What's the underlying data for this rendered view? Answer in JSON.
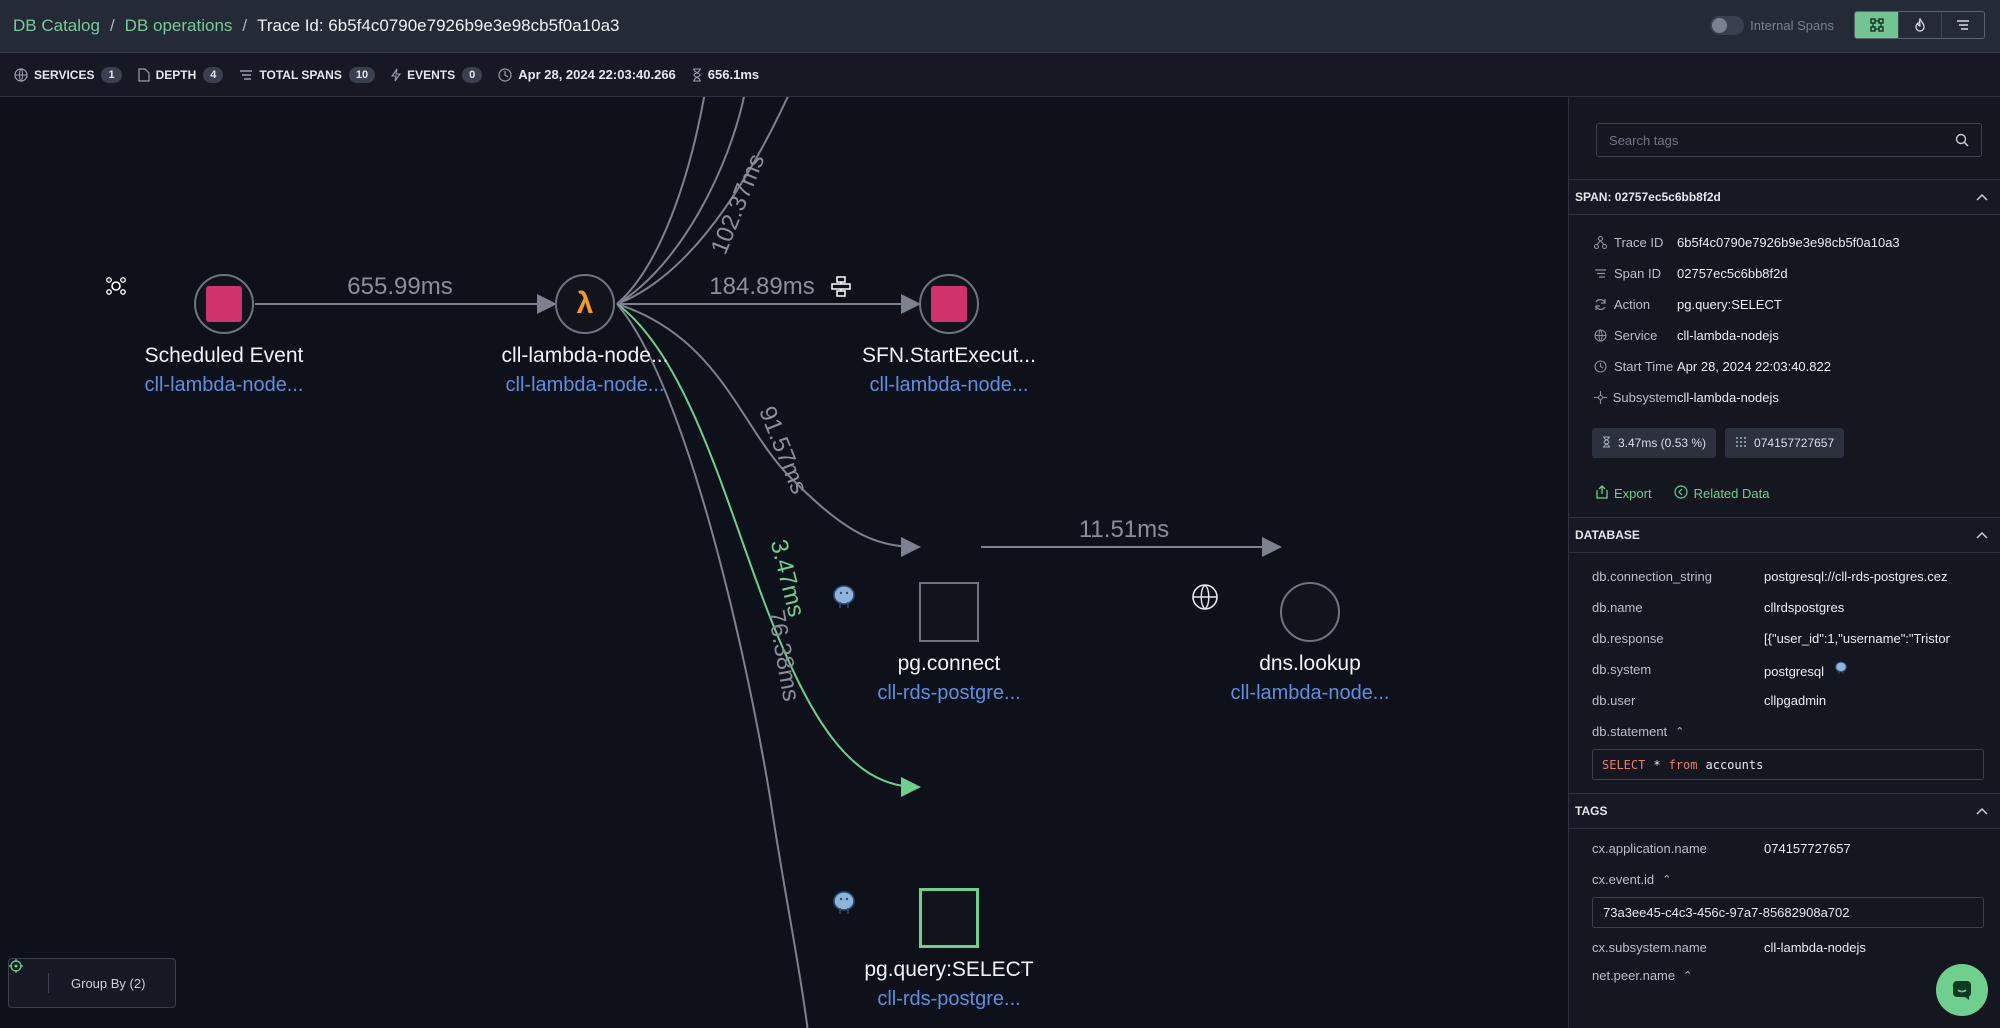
{
  "breadcrumb": [
    "DB Catalog",
    "DB operations",
    "Trace Id: 6b5f4c0790e7926b9e3e98cb5f0a10a3"
  ],
  "top_right": {
    "toggle_label": "Internal Spans",
    "views": [
      "graph-view-icon",
      "flame-view-icon",
      "list-view-icon"
    ]
  },
  "stats": {
    "services_label": "SERVICES",
    "services": "1",
    "depth_label": "DEPTH",
    "depth": "4",
    "total_spans_label": "TOTAL SPANS",
    "total_spans": "10",
    "events_label": "EVENTS",
    "events": "0",
    "start_time": "Apr 28, 2024 22:03:40.266",
    "duration": "656.1ms"
  },
  "graph": {
    "nodes": {
      "scheduled": {
        "name": "Scheduled Event",
        "sub": "cll-lambda-node..."
      },
      "lambda": {
        "name": "cll-lambda-node...",
        "sub": "cll-lambda-node..."
      },
      "sfn": {
        "name": "SFN.StartExecut...",
        "sub": "cll-lambda-node..."
      },
      "pgconnect": {
        "name": "pg.connect",
        "sub": "cll-rds-postgre..."
      },
      "dns": {
        "name": "dns.lookup",
        "sub": "cll-lambda-node..."
      },
      "pgquery": {
        "name": "pg.query:SELECT",
        "sub": "cll-rds-postgre..."
      }
    },
    "edges": {
      "e1": "655.99ms",
      "e2": "184.89ms",
      "e3": "102.37ms",
      "e4": "91.57ms",
      "e5": "11.51ms",
      "e6": "3.47ms",
      "e7": "76.38ms"
    },
    "group_by": "Group By (2)"
  },
  "panel": {
    "search_placeholder": "Search tags",
    "span_header": "SPAN: 02757ec5c6bb8f2d",
    "span_info": [
      {
        "label": "Trace ID",
        "value": "6b5f4c0790e7926b9e3e98cb5f0a10a3"
      },
      {
        "label": "Span ID",
        "value": "02757ec5c6bb8f2d"
      },
      {
        "label": "Action",
        "value": "pg.query:SELECT"
      },
      {
        "label": "Service",
        "value": "cll-lambda-nodejs"
      },
      {
        "label": "Start Time",
        "value": "Apr 28, 2024 22:03:40.822"
      },
      {
        "label": "Subsystem",
        "value": "cll-lambda-nodejs"
      }
    ],
    "chip_duration": "3.47ms (0.53 %)",
    "chip_id": "074157727657",
    "export": "Export",
    "related": "Related Data",
    "database_header": "DATABASE",
    "database": [
      {
        "label": "db.connection_string",
        "value": "postgresql://cll-rds-postgres.cez"
      },
      {
        "label": "db.name",
        "value": "cllrdspostgres"
      },
      {
        "label": "db.response",
        "value": "[{\"user_id\":1,\"username\":\"Tristor"
      },
      {
        "label": "db.system",
        "value": "postgresql"
      },
      {
        "label": "db.user",
        "value": "cllpgadmin"
      }
    ],
    "statement_label": "db.statement",
    "statement_kw1": "SELECT",
    "statement_star": "*",
    "statement_kw2": "from",
    "statement_table": "accounts",
    "tags_header": "TAGS",
    "tags": {
      "app_label": "cx.application.name",
      "app_value": "074157727657",
      "event_label": "cx.event.id",
      "event_value": "73a3ee45-c4c3-456c-97a7-85682908a702",
      "subsystem_label": "cx.subsystem.name",
      "subsystem_value": "cll-lambda-nodejs",
      "peer_label": "net.peer.name"
    }
  },
  "colors": {
    "accent": "#6fcf8e",
    "link_blue": "#5d8fe0",
    "aws_pink": "#d0336c",
    "lambda_orange": "#f29a2e"
  }
}
